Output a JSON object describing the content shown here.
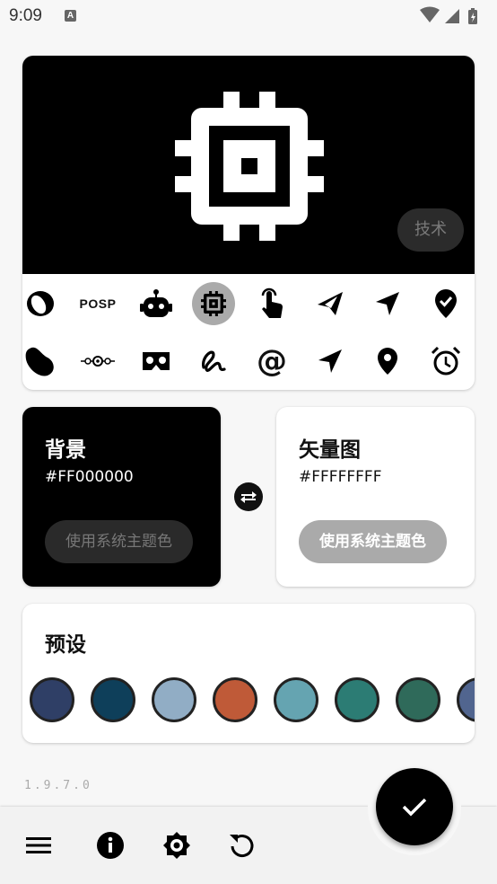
{
  "status": {
    "time": "9:09",
    "notif_icon_letter": "A"
  },
  "preview": {
    "chip_label": "技术",
    "background": "#000000",
    "icon_color": "#FFFFFF"
  },
  "icon_grid": {
    "row1": [
      "bean-outline-icon",
      "posp-text",
      "robot-icon",
      "chip-icon",
      "touch-icon",
      "send-outline-icon",
      "navigation-icon",
      "check-decagram-icon"
    ],
    "row2": [
      "bean-icon",
      "circle-nodes-icon",
      "vr-headset-icon",
      "squiggle-icon",
      "at-icon",
      "send-icon",
      "map-marker-icon",
      "alarm-icon"
    ],
    "posp_label": "POSP",
    "selected": "chip-icon"
  },
  "background_color": {
    "title": "背景",
    "hex": "#FF000000",
    "system_button": "使用系统主题色"
  },
  "vector_color": {
    "title": "矢量图",
    "hex": "#FFFFFFFF",
    "system_button": "使用系统主题色"
  },
  "presets": {
    "title": "预设",
    "swatches": [
      "#2f3f66",
      "#0e3f5a",
      "#91adc5",
      "#bf5a38",
      "#65a4b1",
      "#2c7c74",
      "#2f6a5a",
      "#51658f"
    ]
  },
  "version": "1.9.7.0",
  "bottom_nav": [
    "menu-icon",
    "info-icon",
    "settings-icon",
    "reset-icon"
  ],
  "fab": "check-icon"
}
